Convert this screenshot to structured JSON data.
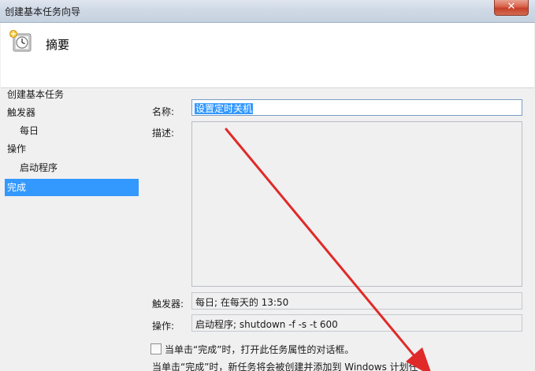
{
  "window": {
    "title": "创建基本任务向导",
    "close_label": "✕"
  },
  "header": {
    "heading": "摘要",
    "icon": "task-clock-icon"
  },
  "nav": {
    "items": [
      {
        "label": "创建基本任务",
        "level": 0,
        "selected": false
      },
      {
        "label": "触发器",
        "level": 0,
        "selected": false
      },
      {
        "label": "每日",
        "level": 1,
        "selected": false
      },
      {
        "label": "操作",
        "level": 0,
        "selected": false
      },
      {
        "label": "启动程序",
        "level": 1,
        "selected": false
      },
      {
        "label": "完成",
        "level": 0,
        "selected": true
      }
    ]
  },
  "form": {
    "name_label": "名称:",
    "name_value": "设置定时关机",
    "description_label": "描述:",
    "description_value": "",
    "trigger_label": "触发器:",
    "trigger_value": "每日; 在每天的 13:50",
    "action_label": "操作:",
    "action_value": "启动程序; shutdown -f -s -t 600",
    "open_properties_checkbox": {
      "label": "当单击“完成”时，打开此任务属性的对话框。",
      "checked": false
    },
    "note": "当单击“完成”时，新任务将会被创建并添加到 Windows 计划任"
  },
  "colors": {
    "selection": "#3399ff",
    "annotation_arrow": "#e02a2a"
  }
}
